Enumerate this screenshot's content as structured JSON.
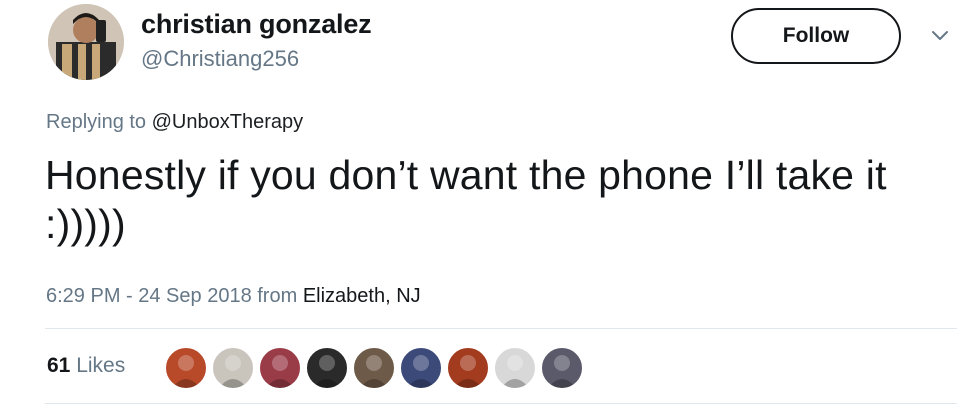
{
  "author": {
    "name": "christian gonzalez",
    "handle": "@Christiang256",
    "avatar_icon": "profile-photo"
  },
  "actions": {
    "follow_label": "Follow",
    "menu_icon": "chevron-down-icon"
  },
  "reply": {
    "prefix": "Replying to ",
    "mention": "@UnboxTherapy"
  },
  "tweet": {
    "text": "Honestly if you don’t want the phone I’ll take it :)))))"
  },
  "meta": {
    "timestamp": "6:29 PM - 24 Sep 2018 from ",
    "location": "Elizabeth, NJ"
  },
  "likes": {
    "count": "61",
    "label": " Likes",
    "avatars": [
      {
        "name": "liker-avatar-1",
        "color": "#b84a2a"
      },
      {
        "name": "liker-avatar-2",
        "color": "#c9c4bc"
      },
      {
        "name": "liker-avatar-3",
        "color": "#9a3b48"
      },
      {
        "name": "liker-avatar-4",
        "color": "#2a2a2a"
      },
      {
        "name": "liker-avatar-5",
        "color": "#6e5a48"
      },
      {
        "name": "liker-avatar-6",
        "color": "#3c4a7a"
      },
      {
        "name": "liker-avatar-7",
        "color": "#a33b1f"
      },
      {
        "name": "liker-avatar-8",
        "color": "#d8d8d8"
      },
      {
        "name": "liker-avatar-9",
        "color": "#5a5a6a"
      }
    ]
  }
}
